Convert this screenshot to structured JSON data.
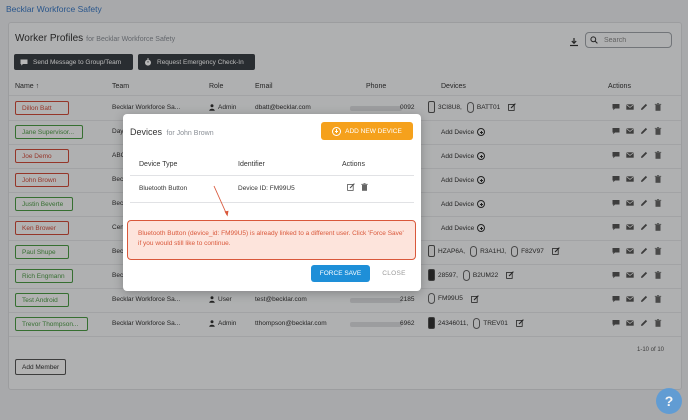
{
  "app": {
    "brand": "Becklar Workforce Safety"
  },
  "page": {
    "title": "Worker Profiles",
    "subtitle": "for Becklar Workforce Safety"
  },
  "search": {
    "placeholder": "Search"
  },
  "toolbar": {
    "send_message": "Send Message to Group/Team",
    "emergency_checkin": "Request Emergency Check-In"
  },
  "columns": {
    "name": "Name",
    "team": "Team",
    "role": "Role",
    "email": "Email",
    "phone": "Phone",
    "devices": "Devices",
    "actions": "Actions"
  },
  "rows": [
    {
      "name": "Dillon Batt",
      "status": "red",
      "team": "Becklar Workforce Sa...",
      "role": "Admin",
      "email": "dbatt@becklar.com",
      "phone_suffix": "0092",
      "devices": [
        "3CI8U8,",
        "BATT01"
      ]
    },
    {
      "name": "Jane Supervisor...",
      "status": "green",
      "team": "Day",
      "role": "",
      "email": "",
      "phone_suffix": "",
      "add_device": "Add Device"
    },
    {
      "name": "Joe Demo",
      "status": "red",
      "team": "ABC",
      "role": "",
      "email": "",
      "phone_suffix": "",
      "add_device": "Add Device"
    },
    {
      "name": "John Brown",
      "status": "red",
      "team": "Bec",
      "role": "",
      "email": "",
      "phone_suffix": "",
      "add_device": "Add Device"
    },
    {
      "name": "Justin Beverte",
      "status": "green",
      "team": "Bec",
      "role": "",
      "email": "",
      "phone_suffix": "",
      "add_device": "Add Device"
    },
    {
      "name": "Ken Brower",
      "status": "red",
      "team": "Cen",
      "role": "",
      "email": "",
      "phone_suffix": "",
      "add_device": "Add Device"
    },
    {
      "name": "Paul Shupe",
      "status": "green",
      "team": "Bec",
      "role": "",
      "email": "",
      "phone_suffix": "",
      "devices": [
        "HZAP6A,",
        "R3A1HJ,",
        "F82V97"
      ]
    },
    {
      "name": "Rich Engmann",
      "status": "green",
      "team": "Bec",
      "role": "",
      "email": "",
      "phone_suffix": "",
      "devices": [
        "28597,",
        "B2UM22"
      ]
    },
    {
      "name": "Test Android",
      "status": "green",
      "team": "Becklar Workforce Sa...",
      "role": "User",
      "email": "test@becklar.com",
      "phone_suffix": "2185",
      "devices": [
        "FM99U5"
      ]
    },
    {
      "name": "Trevor Thompson...",
      "status": "green",
      "team": "Becklar Workforce Sa...",
      "role": "Admin",
      "email": "tthompson@becklar.com",
      "phone_suffix": "6962",
      "devices": [
        "24346011,",
        "TREV01"
      ]
    }
  ],
  "pagination": {
    "label": "1-10 of 10"
  },
  "add_member": "Add Member",
  "modal": {
    "title": "Devices",
    "subtitle": "for John Brown",
    "add_new": "ADD NEW DEVICE",
    "col_type": "Device Type",
    "col_identifier": "Identifier",
    "col_actions": "Actions",
    "device_type": "Bluetooth Button",
    "device_identifier": "Device ID: FM99U5",
    "alert": "Bluetooth Button (device_id: FM99U5) is already linked to a different user. Click 'Force Save' if you would still like to continue.",
    "force_save": "FORCE SAVE",
    "close": "CLOSE"
  },
  "help": "?",
  "colors": {
    "accent_orange": "#f5a11c",
    "primary_blue": "#1e8fd8",
    "alert_red": "#d9583b",
    "status_red": "#cf4b3a",
    "status_green": "#4c9a45"
  }
}
